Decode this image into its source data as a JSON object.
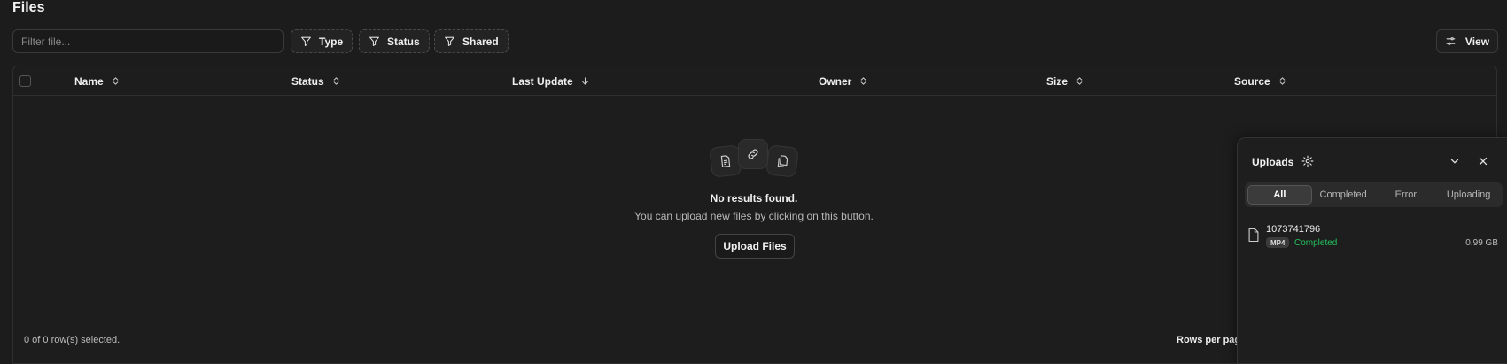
{
  "page": {
    "title": "Files"
  },
  "toolbar": {
    "filter_placeholder": "Filter file...",
    "filters": [
      {
        "label": "Type",
        "icon": "filter-icon"
      },
      {
        "label": "Status",
        "icon": "filter-icon"
      },
      {
        "label": "Shared",
        "icon": "filter-icon"
      }
    ],
    "view_label": "View",
    "view_icon": "sliders-icon"
  },
  "table": {
    "columns": [
      {
        "label": "Name",
        "sort": "none"
      },
      {
        "label": "Status",
        "sort": "none"
      },
      {
        "label": "Last Update",
        "sort": "desc"
      },
      {
        "label": "Owner",
        "sort": "none"
      },
      {
        "label": "Size",
        "sort": "none"
      },
      {
        "label": "Source",
        "sort": "none"
      }
    ],
    "rows": [],
    "empty": {
      "title": "No results found.",
      "subtitle": "You can upload new files by clicking on this button.",
      "button_label": "Upload Files",
      "icons": [
        "document-icon",
        "link-icon",
        "copy-icon"
      ]
    },
    "footer": {
      "selected_text": "0 of 0 row(s) selected.",
      "rows_per_page_label": "Rows per pag"
    }
  },
  "uploads": {
    "title": "Uploads",
    "tabs": [
      {
        "label": "All",
        "active": true
      },
      {
        "label": "Completed",
        "active": false
      },
      {
        "label": "Error",
        "active": false
      },
      {
        "label": "Uploading",
        "active": false
      }
    ],
    "items": [
      {
        "name": "1073741796",
        "type": "MP4",
        "status": "Completed",
        "size": "0.99 GB"
      }
    ]
  },
  "colors": {
    "background": "#1c1c1c",
    "status_completed": "#22c55e",
    "text": "#e8e8e8"
  }
}
